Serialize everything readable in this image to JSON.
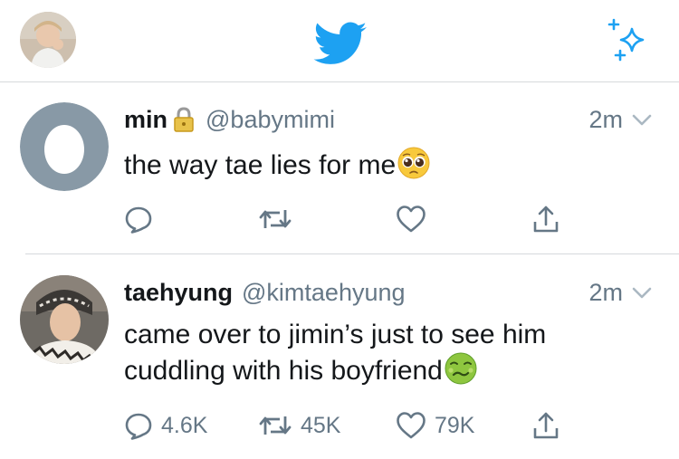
{
  "tweets": [
    {
      "name": "min",
      "handle": "@babymimi",
      "time": "2m",
      "text": "the way tae lies for me",
      "emoji": "pleading-face",
      "locked": true,
      "replies": "",
      "retweets": "",
      "likes": ""
    },
    {
      "name": "taehyung",
      "handle": "@kimtaehyung",
      "time": "2m",
      "text": "came over to jimin’s just to see him cuddling with his boyfriend",
      "emoji": "nauseated-face",
      "locked": false,
      "replies": "4.6K",
      "retweets": "45K",
      "likes": "79K"
    }
  ],
  "colors": {
    "brand": "#1da1f2",
    "secondary_text": "#657786",
    "primary_text": "#14171a",
    "divider": "#d6d9dc",
    "egg_avatar": "#8899a6"
  },
  "icons": {
    "header_left": "profile-avatar",
    "header_center": "twitter-bird-icon",
    "header_right": "sparkle-icon",
    "actions": [
      "reply-icon",
      "retweet-icon",
      "like-icon",
      "share-icon"
    ]
  }
}
